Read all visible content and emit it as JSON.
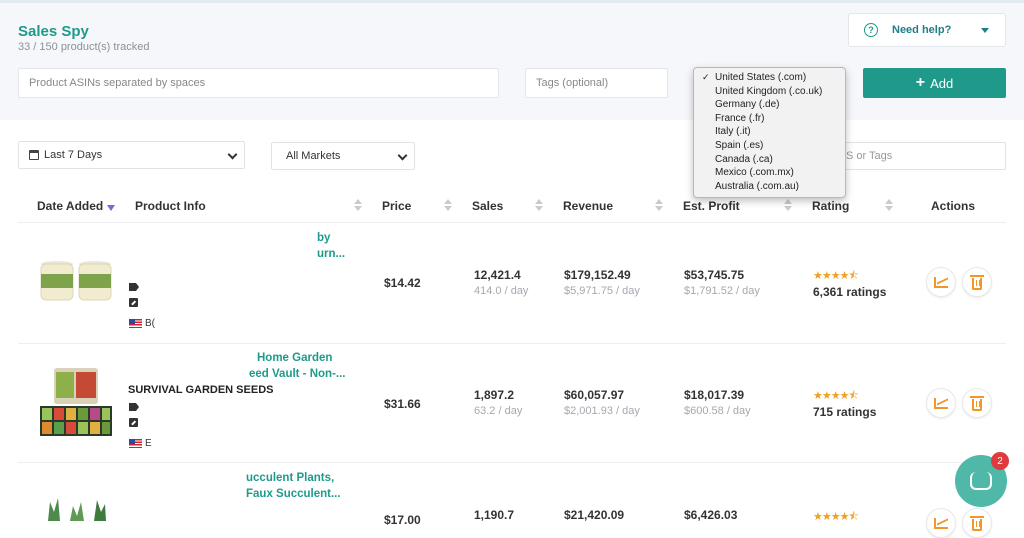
{
  "header": {
    "title": "Sales Spy",
    "subtitle": "33 / 150 product(s) tracked",
    "help_label": "Need help?",
    "help_icon": "question-circle-icon"
  },
  "form": {
    "asin_placeholder": "Product ASINs separated by spaces",
    "tags_placeholder": "Tags (optional)",
    "add_label": "Add",
    "markets": [
      "United States (.com)",
      "United Kingdom (.co.uk)",
      "Germany (.de)",
      "France (.fr)",
      "Italy (.it)",
      "Spain (.es)",
      "Canada (.ca)",
      "Mexico (.com.mx)",
      "Australia (.com.au)"
    ],
    "selected_market": "United States (.com)",
    "check_mark": "✓"
  },
  "filters": {
    "date_range": "Last 7 Days",
    "market_filter": "All Markets",
    "search_placeholder_visible": "S or Tags"
  },
  "table": {
    "columns": [
      "Date Added",
      "Product Info",
      "Price",
      "Sales",
      "Revenue",
      "Est. Profit",
      "Rating",
      "Actions"
    ],
    "rows": [
      {
        "name_line1": "by",
        "name_line2": "urn...",
        "asin_partial": "B(",
        "price": "$14.42",
        "sales": "12,421.4",
        "sales_day": "414.0 / day",
        "revenue": "$179,152.49",
        "revenue_day": "$5,971.75 / day",
        "profit": "$53,745.75",
        "profit_day": "$1,791.52 / day",
        "stars": "★★★★⯪",
        "ratings": "6,361 ratings"
      },
      {
        "name_line1": "Home Garden",
        "name_line2": "eed Vault - Non-...",
        "name_overlay": "SURVIVAL GARDEN SEEDS",
        "asin_partial": "E",
        "price": "$31.66",
        "sales": "1,897.2",
        "sales_day": "63.2 / day",
        "revenue": "$60,057.97",
        "revenue_day": "$2,001.93 / day",
        "profit": "$18,017.39",
        "profit_day": "$600.58 / day",
        "stars": "★★★★⯪",
        "ratings": "715 ratings"
      },
      {
        "name_line1": "ucculent Plants,",
        "name_line2": "Faux Succulent...",
        "price": "$17.00",
        "sales": "1,190.7",
        "revenue": "$21,420.09",
        "profit": "$6,426.03",
        "stars": "★★★★⯪"
      }
    ]
  },
  "chat": {
    "badge": "2"
  },
  "colors": {
    "accent": "#1f9a8a",
    "action": "#f0962a",
    "badge": "#e03a3e"
  }
}
